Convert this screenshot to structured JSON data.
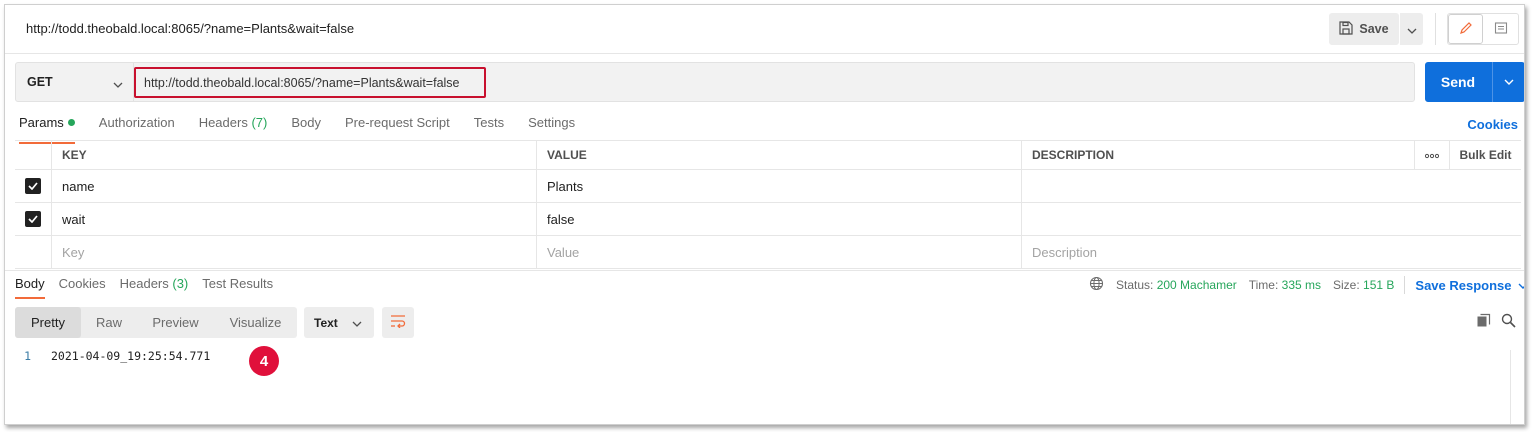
{
  "window": {
    "title": "http://todd.theobald.local:8065/?name=Plants&wait=false",
    "save_label": "Save"
  },
  "request": {
    "method": "GET",
    "url": "http://todd.theobald.local:8065/?name=Plants&wait=false",
    "send_label": "Send"
  },
  "request_tabs": {
    "params": "Params",
    "authorization": "Authorization",
    "headers": "Headers",
    "headers_count": "(7)",
    "body": "Body",
    "prerequest": "Pre-request Script",
    "tests": "Tests",
    "settings": "Settings",
    "cookies": "Cookies"
  },
  "params_table": {
    "headers": {
      "key": "KEY",
      "value": "VALUE",
      "description": "DESCRIPTION",
      "more": "ooo",
      "bulk_edit": "Bulk Edit"
    },
    "rows": [
      {
        "checked": true,
        "key": "name",
        "value": "Plants",
        "description": ""
      },
      {
        "checked": true,
        "key": "wait",
        "value": "false",
        "description": ""
      }
    ],
    "placeholders": {
      "key": "Key",
      "value": "Value",
      "description": "Description"
    }
  },
  "response_tabs": {
    "body": "Body",
    "cookies": "Cookies",
    "headers": "Headers",
    "headers_count": "(3)",
    "test_results": "Test Results"
  },
  "response_status": {
    "status_label": "Status:",
    "status_value": "200 Machamer",
    "time_label": "Time:",
    "time_value": "335 ms",
    "size_label": "Size:",
    "size_value": "151 B",
    "save_response": "Save Response"
  },
  "response_view": {
    "modes": [
      "Pretty",
      "Raw",
      "Preview",
      "Visualize"
    ],
    "active_mode": "Pretty",
    "format": "Text"
  },
  "response_body": {
    "line_number": "1",
    "line_text": "2021-04-09_19:25:54.771"
  },
  "annotation": {
    "badge": "4",
    "color": "#e0103b"
  },
  "colors": {
    "accent_blue": "#0f6fdc",
    "active_tab_underline": "#f26b3a",
    "status_green": "#26a65b",
    "url_highlight": "#c8102e"
  }
}
